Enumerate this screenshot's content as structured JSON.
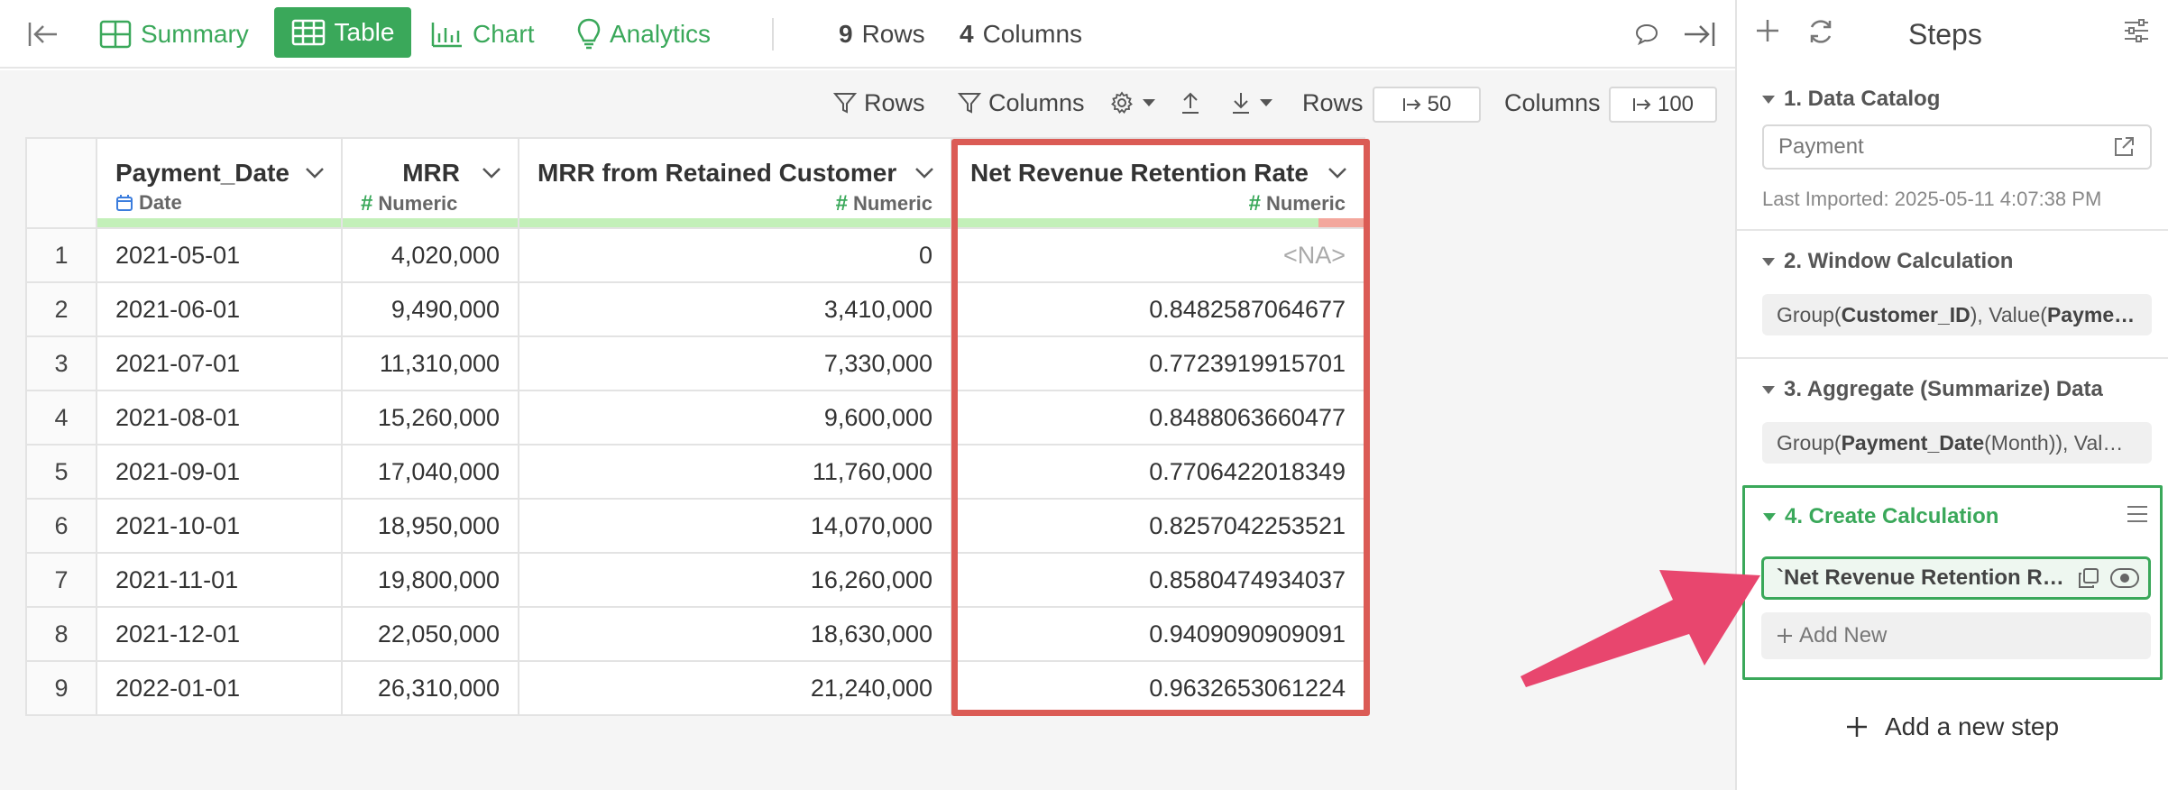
{
  "toolbar": {
    "tabs": {
      "summary": "Summary",
      "table": "Table",
      "chart": "Chart",
      "analytics": "Analytics"
    },
    "active_tab": "Table",
    "row_count": "9",
    "rows_label": "Rows",
    "column_count": "4",
    "columns_label": "Columns"
  },
  "subbar": {
    "filter_rows": "Rows",
    "filter_columns": "Columns",
    "rows_label": "Rows",
    "rows_value": "50",
    "columns_label": "Columns",
    "columns_value": "100"
  },
  "table": {
    "columns": [
      {
        "name": "Payment_Date",
        "type": "Date"
      },
      {
        "name": "MRR",
        "type": "Numeric"
      },
      {
        "name": "MRR from Retained Customer",
        "type": "Numeric"
      },
      {
        "name": "Net Revenue Retention Rate",
        "type": "Numeric"
      }
    ],
    "rows": [
      {
        "idx": "1",
        "date": "2021-05-01",
        "mrr": "4,020,000",
        "retained": "0",
        "nrr": "<NA>"
      },
      {
        "idx": "2",
        "date": "2021-06-01",
        "mrr": "9,490,000",
        "retained": "3,410,000",
        "nrr": "0.8482587064677"
      },
      {
        "idx": "3",
        "date": "2021-07-01",
        "mrr": "11,310,000",
        "retained": "7,330,000",
        "nrr": "0.7723919915701"
      },
      {
        "idx": "4",
        "date": "2021-08-01",
        "mrr": "15,260,000",
        "retained": "9,600,000",
        "nrr": "0.8488063660477"
      },
      {
        "idx": "5",
        "date": "2021-09-01",
        "mrr": "17,040,000",
        "retained": "11,760,000",
        "nrr": "0.7706422018349"
      },
      {
        "idx": "6",
        "date": "2021-10-01",
        "mrr": "18,950,000",
        "retained": "14,070,000",
        "nrr": "0.8257042253521"
      },
      {
        "idx": "7",
        "date": "2021-11-01",
        "mrr": "19,800,000",
        "retained": "16,260,000",
        "nrr": "0.8580474934037"
      },
      {
        "idx": "8",
        "date": "2021-12-01",
        "mrr": "22,050,000",
        "retained": "18,630,000",
        "nrr": "0.9409090909091"
      },
      {
        "idx": "9",
        "date": "2022-01-01",
        "mrr": "26,310,000",
        "retained": "21,240,000",
        "nrr": "0.9632653061224"
      }
    ]
  },
  "steps": {
    "title": "Steps",
    "items": [
      {
        "title": "1. Data Catalog",
        "source": "Payment",
        "meta": "Last Imported: 2025-05-11 4:07:38 PM"
      },
      {
        "title": "2. Window Calculation",
        "detail_prefix": "Group(",
        "detail_b1": "Customer_ID",
        "detail_mid": "), Value(",
        "detail_b2": "Payme…"
      },
      {
        "title": "3. Aggregate (Summarize) Data",
        "detail_prefix": "Group(",
        "detail_b1": "Payment_Date",
        "detail_mid": " (Month)), Val…"
      },
      {
        "title": "4. Create Calculation",
        "calc_item": "`Net Revenue Retention R…",
        "add_new": "Add New"
      }
    ],
    "add_step": "Add a new step"
  },
  "colors": {
    "accent": "#3aa85a",
    "highlight": "#db5b55",
    "arrow": "#e8466e"
  }
}
